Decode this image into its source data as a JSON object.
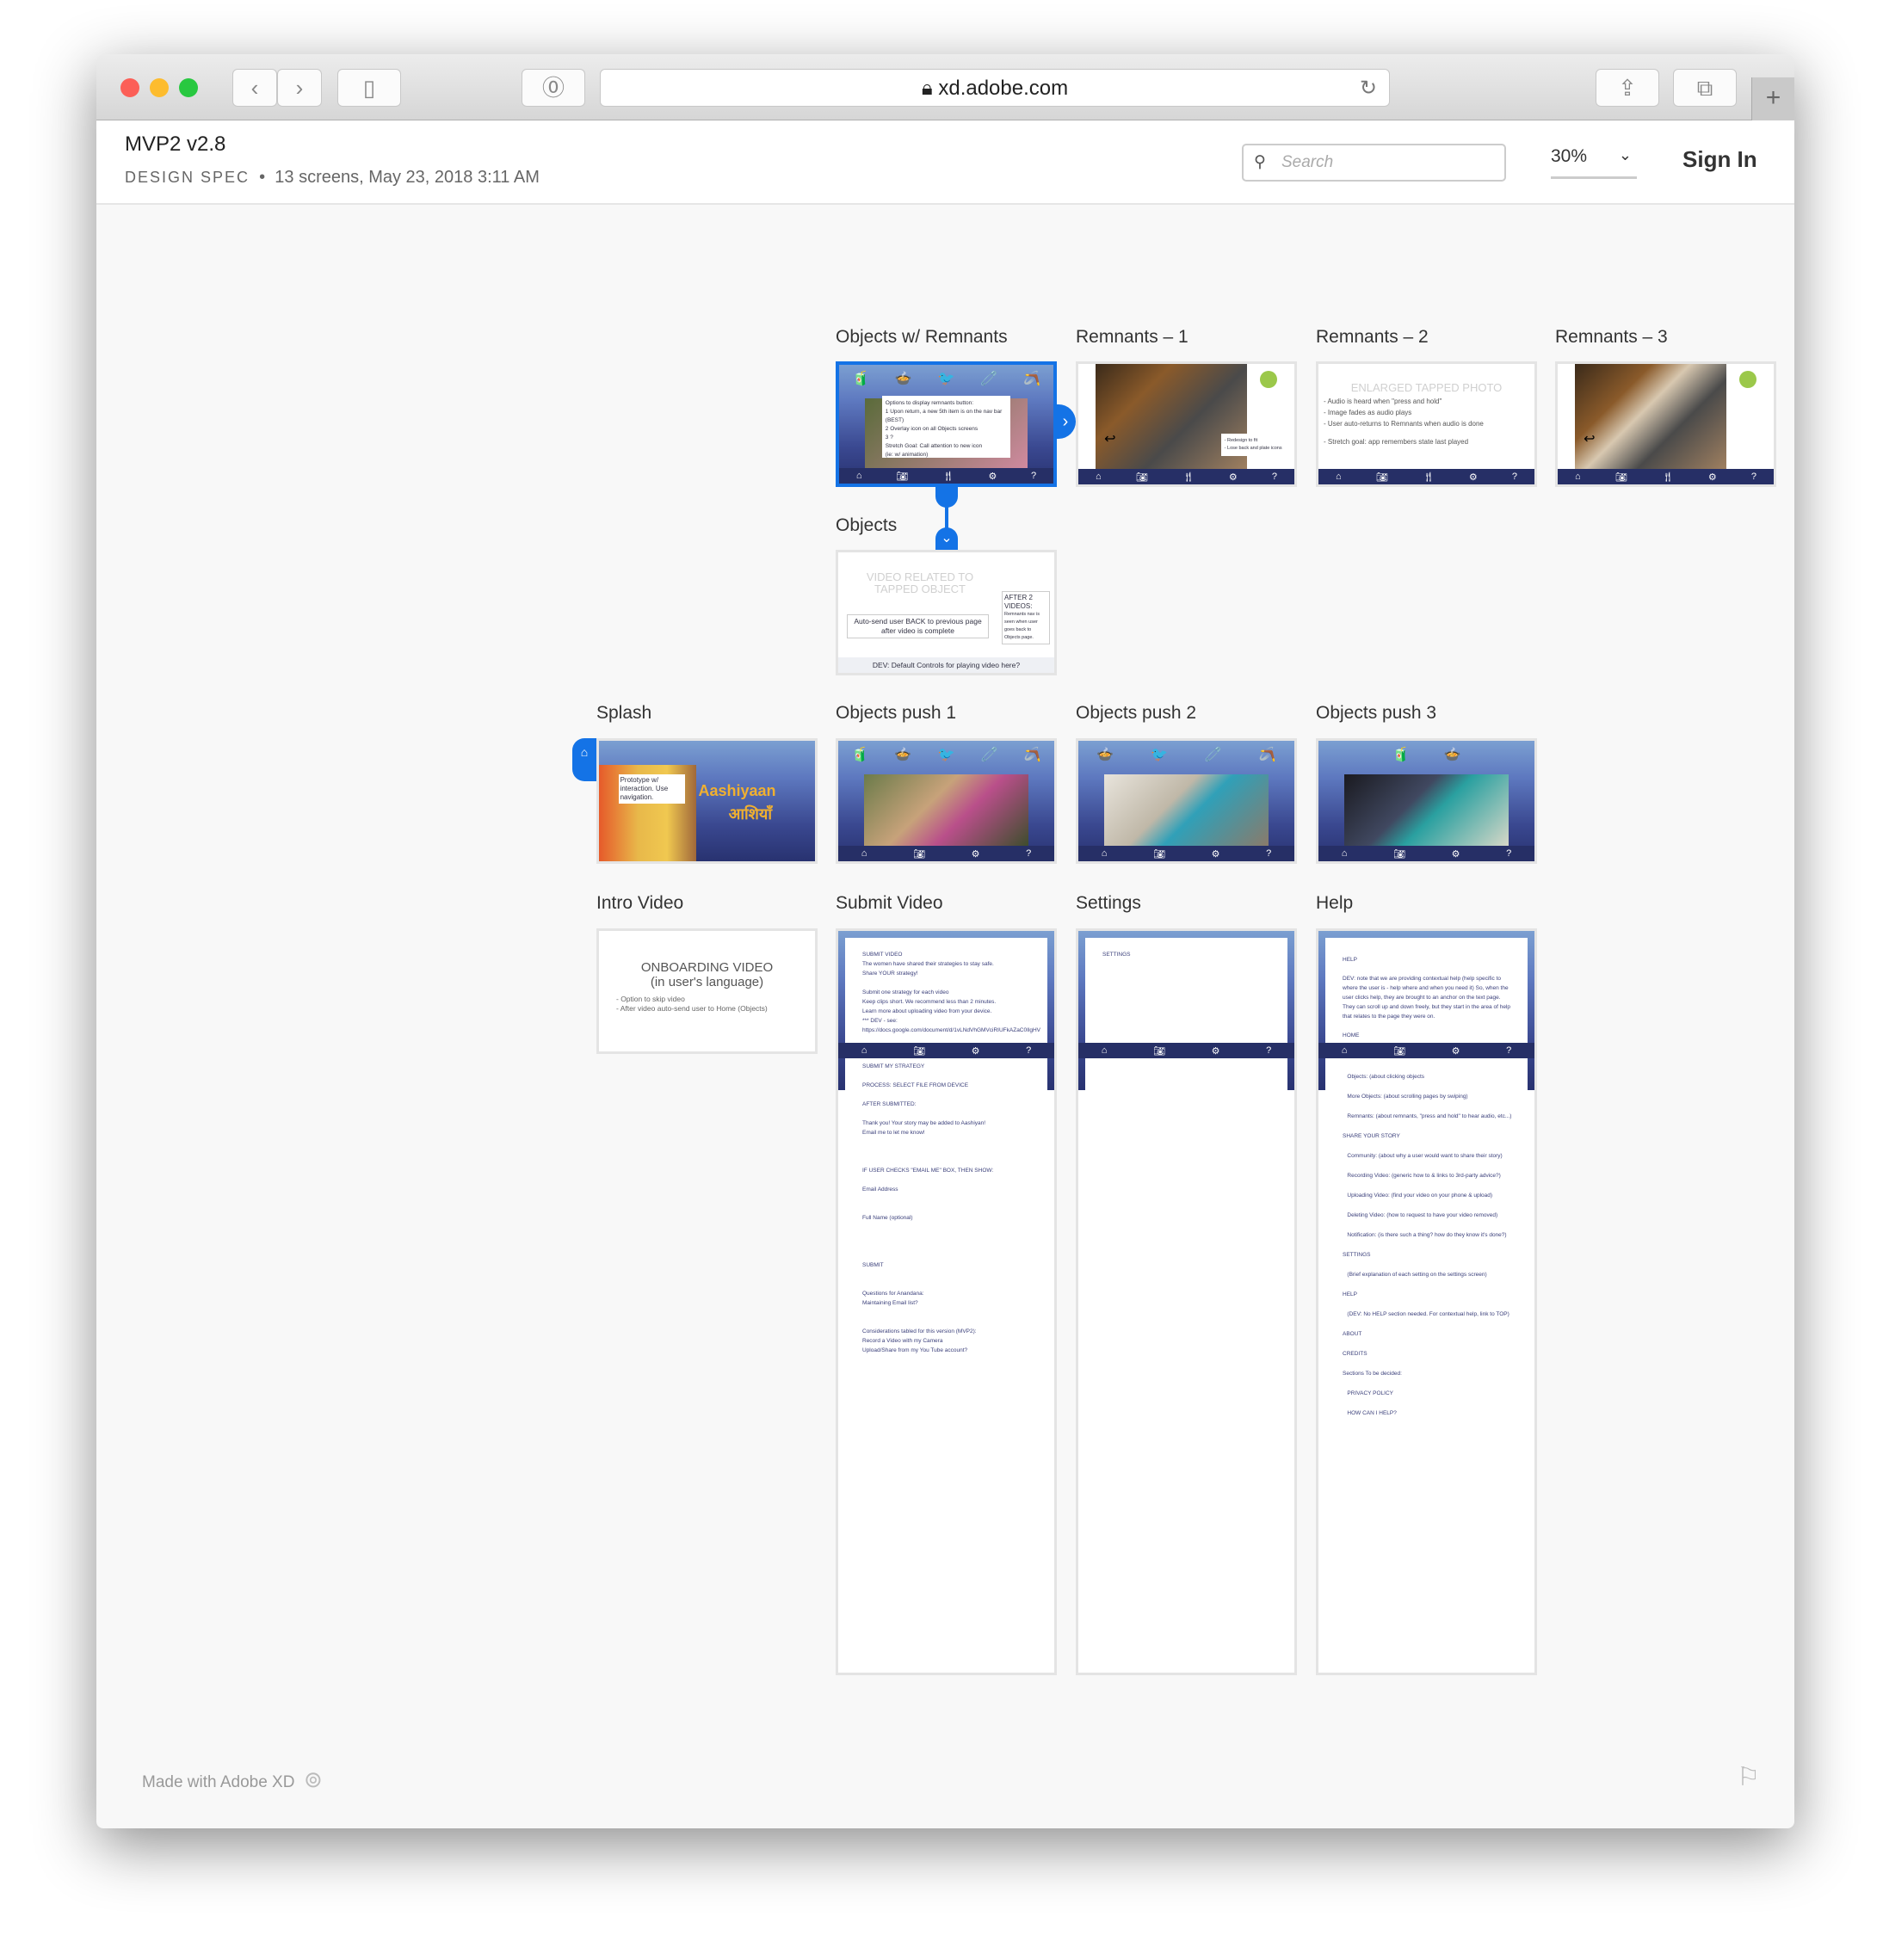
{
  "browser": {
    "url": "xd.adobe.com",
    "lock_icon": "lock-icon",
    "buttons": [
      "back",
      "forward",
      "sidebar",
      "password",
      "reload",
      "share",
      "tabs",
      "new-tab"
    ]
  },
  "header": {
    "title": "MVP2 v2.8",
    "spec_label": "DESIGN SPEC",
    "meta": "13 screens, May 23, 2018 3:11 AM",
    "search_placeholder": "Search",
    "zoom": "30%",
    "sign_in": "Sign In"
  },
  "screens": {
    "objects_remnants": {
      "label": "Objects w/ Remnants",
      "note": [
        "Options to display remnants button:",
        "1 Upon return, a new 5th item is on the nav bar (BEST)",
        "2 Overlay icon on all Objects screens",
        "3 ?",
        "Stretch Goal: Call attention to new icon",
        "(ie: w/ animation)"
      ]
    },
    "remnants1": {
      "label": "Remnants – 1",
      "note": [
        "- Redesign to fit",
        "- Lose back and plate icons"
      ]
    },
    "remnants2": {
      "label": "Remnants – 2",
      "heading": "ENLARGED TAPPED PHOTO",
      "lines": [
        "- Audio is heard when \"press and hold\"",
        "- Image fades as audio plays",
        "- User auto-returns to Remnants when audio is done",
        "- Stretch goal: app remembers state last played"
      ]
    },
    "remnants3": {
      "label": "Remnants – 3"
    },
    "objects": {
      "label": "Objects",
      "heading": "VIDEO RELATED TO TAPPED OBJECT",
      "box": "Auto-send user BACK to previous page after video is complete",
      "side_title": "AFTER 2 VIDEOS:",
      "side_text": "Remnants nav is seen when user goes back to Objects page.",
      "footer": "DEV: Default Controls for playing video here?"
    },
    "splash": {
      "label": "Splash",
      "note": "Prototype w/ interaction. Use navigation.",
      "logo": "Aashiyaan",
      "logo_hindi": "आशियाँ"
    },
    "push1": {
      "label": "Objects push 1"
    },
    "push2": {
      "label": "Objects push 2"
    },
    "push3": {
      "label": "Objects push 3"
    },
    "intro": {
      "label": "Intro Video",
      "heading": "ONBOARDING VIDEO",
      "subheading": "(in user's language)",
      "lines": [
        "- Option to skip video",
        "- After video auto-send user to Home (Objects)"
      ]
    },
    "submit": {
      "label": "Submit Video",
      "top": [
        "SUBMIT VIDEO",
        "The women have shared their strategies to stay safe.",
        "Share YOUR strategy!",
        "",
        "Submit one strategy for each video",
        "Keep clips short. We recommend less than 2 minutes.",
        "Learn more about uploading video from your device.",
        "*** DEV - see:",
        "https://docs.google.com/document/d/1vLNdVhGMVciRIUFkAZaC0IlgHV"
      ],
      "body": [
        "SUBMIT MY STRATEGY",
        "",
        "PROCESS: SELECT FILE FROM DEVICE",
        "",
        "AFTER SUBMITTED:",
        "",
        "Thank you! Your story may be added to Aashiyan!",
        "Email me to let me know!",
        "",
        "",
        "",
        "IF USER CHECKS \"EMAIL ME\" BOX, THEN SHOW:",
        "",
        "Email Address",
        "",
        "",
        "Full Name (optional)",
        "",
        "",
        "",
        "",
        "SUBMIT",
        "",
        "",
        "Questions for Anandana:",
        "Maintaining Email list?",
        "",
        "",
        "Considerations tabled for this version (MVP2):",
        "Record a Video with my Camera",
        "Upload/Share from my You Tube account?"
      ]
    },
    "settings": {
      "label": "Settings",
      "top": [
        "SETTINGS"
      ]
    },
    "help": {
      "label": "Help",
      "top": [
        "HELP",
        "",
        "DEV: note that we are providing contextual help (help specific to where the user is - help where and when you need it) So, when the user clicks help, they are brought to an anchor on the text page. They can scroll up and down freely, but they start in the area of help that relates to the page they were on.",
        "",
        "HOME"
      ],
      "body": [
        "   Objects: (about clicking objects",
        "   More Objects: (about scrolling pages by swiping)",
        "   Remnants: (about remnants, \"press and hold\" to hear audio, etc...)",
        "SHARE YOUR STORY",
        "   Community: (about why a user would want to share their story)",
        "   Recording Video: (generic how to & links to 3rd-party advice?)",
        "   Uploading Video: (find your video on your phone & upload)",
        "   Deleting Video: (how to request to have your video removed)",
        "   Notification: (is there such a thing? how do they know it's done?)",
        "SETTINGS",
        "   (Brief explanation of each setting on the settings screen)",
        "HELP",
        "   (DEV: No HELP section needed. For contextual help, link to TOP)",
        "ABOUT",
        "CREDITS",
        "Sections To be decided:",
        "   PRIVACY POLICY",
        "   HOW CAN I HELP?"
      ]
    }
  },
  "footer": {
    "text": "Made with Adobe XD",
    "logo": "creative-cloud-logo"
  },
  "colors": {
    "accent": "#1473e6",
    "navbar": "#262f66",
    "text": "#3a3f7a"
  }
}
